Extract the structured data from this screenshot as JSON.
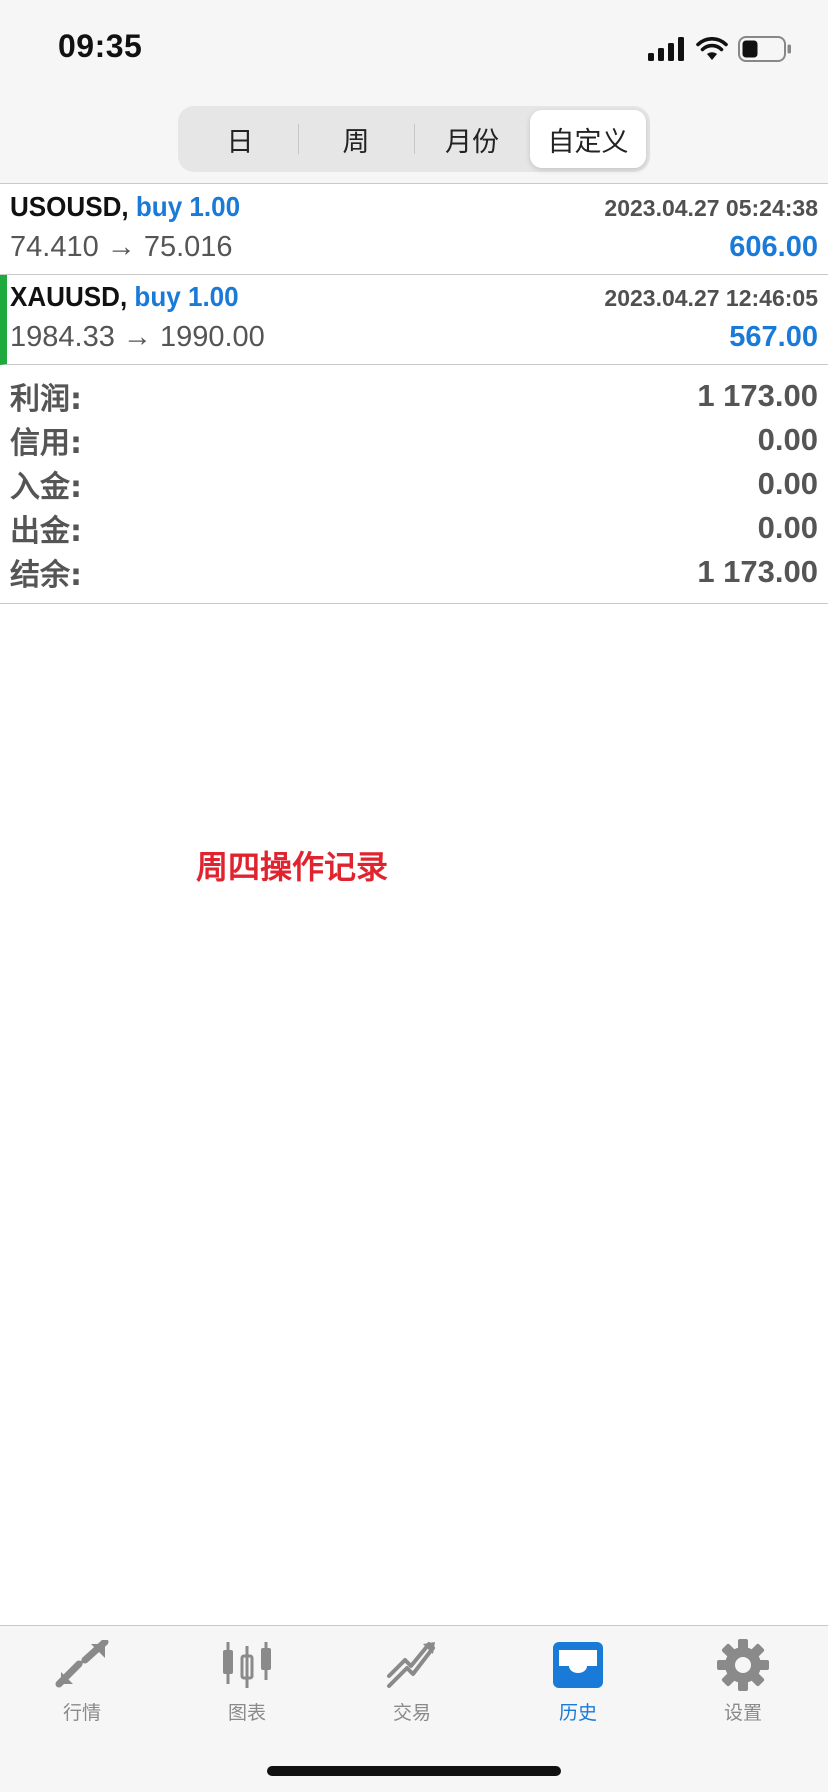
{
  "status_bar": {
    "time": "09:35"
  },
  "segment": {
    "options": [
      "日",
      "周",
      "月份",
      "自定义"
    ],
    "selected": "自定义"
  },
  "deals": [
    {
      "symbol": "USOUSD,",
      "type": "buy 1.00",
      "datetime": "2023.04.27 05:24:38",
      "prices": "74.410 → 75.016",
      "profit": "606.00",
      "highlighted": false
    },
    {
      "symbol": "XAUUSD,",
      "type": "buy 1.00",
      "datetime": "2023.04.27 12:46:05",
      "prices": "1984.33 → 1990.00",
      "profit": "567.00",
      "highlighted": true
    }
  ],
  "summary": [
    {
      "label": "利润:",
      "value": "1 173.00"
    },
    {
      "label": "信用:",
      "value": "0.00"
    },
    {
      "label": "入金:",
      "value": "0.00"
    },
    {
      "label": "出金:",
      "value": "0.00"
    },
    {
      "label": "结余:",
      "value": "1 173.00"
    }
  ],
  "note": "周四操作记录",
  "tabs": [
    {
      "label": "行情",
      "icon": "quotes-icon"
    },
    {
      "label": "图表",
      "icon": "chart-candles-icon"
    },
    {
      "label": "交易",
      "icon": "trade-icon"
    },
    {
      "label": "历史",
      "icon": "history-inbox-icon",
      "active": true
    },
    {
      "label": "设置",
      "icon": "gear-icon"
    }
  ],
  "colors": {
    "accent": "#1a7ad8",
    "highlight": "#1faa3f",
    "note": "#e0242f"
  }
}
